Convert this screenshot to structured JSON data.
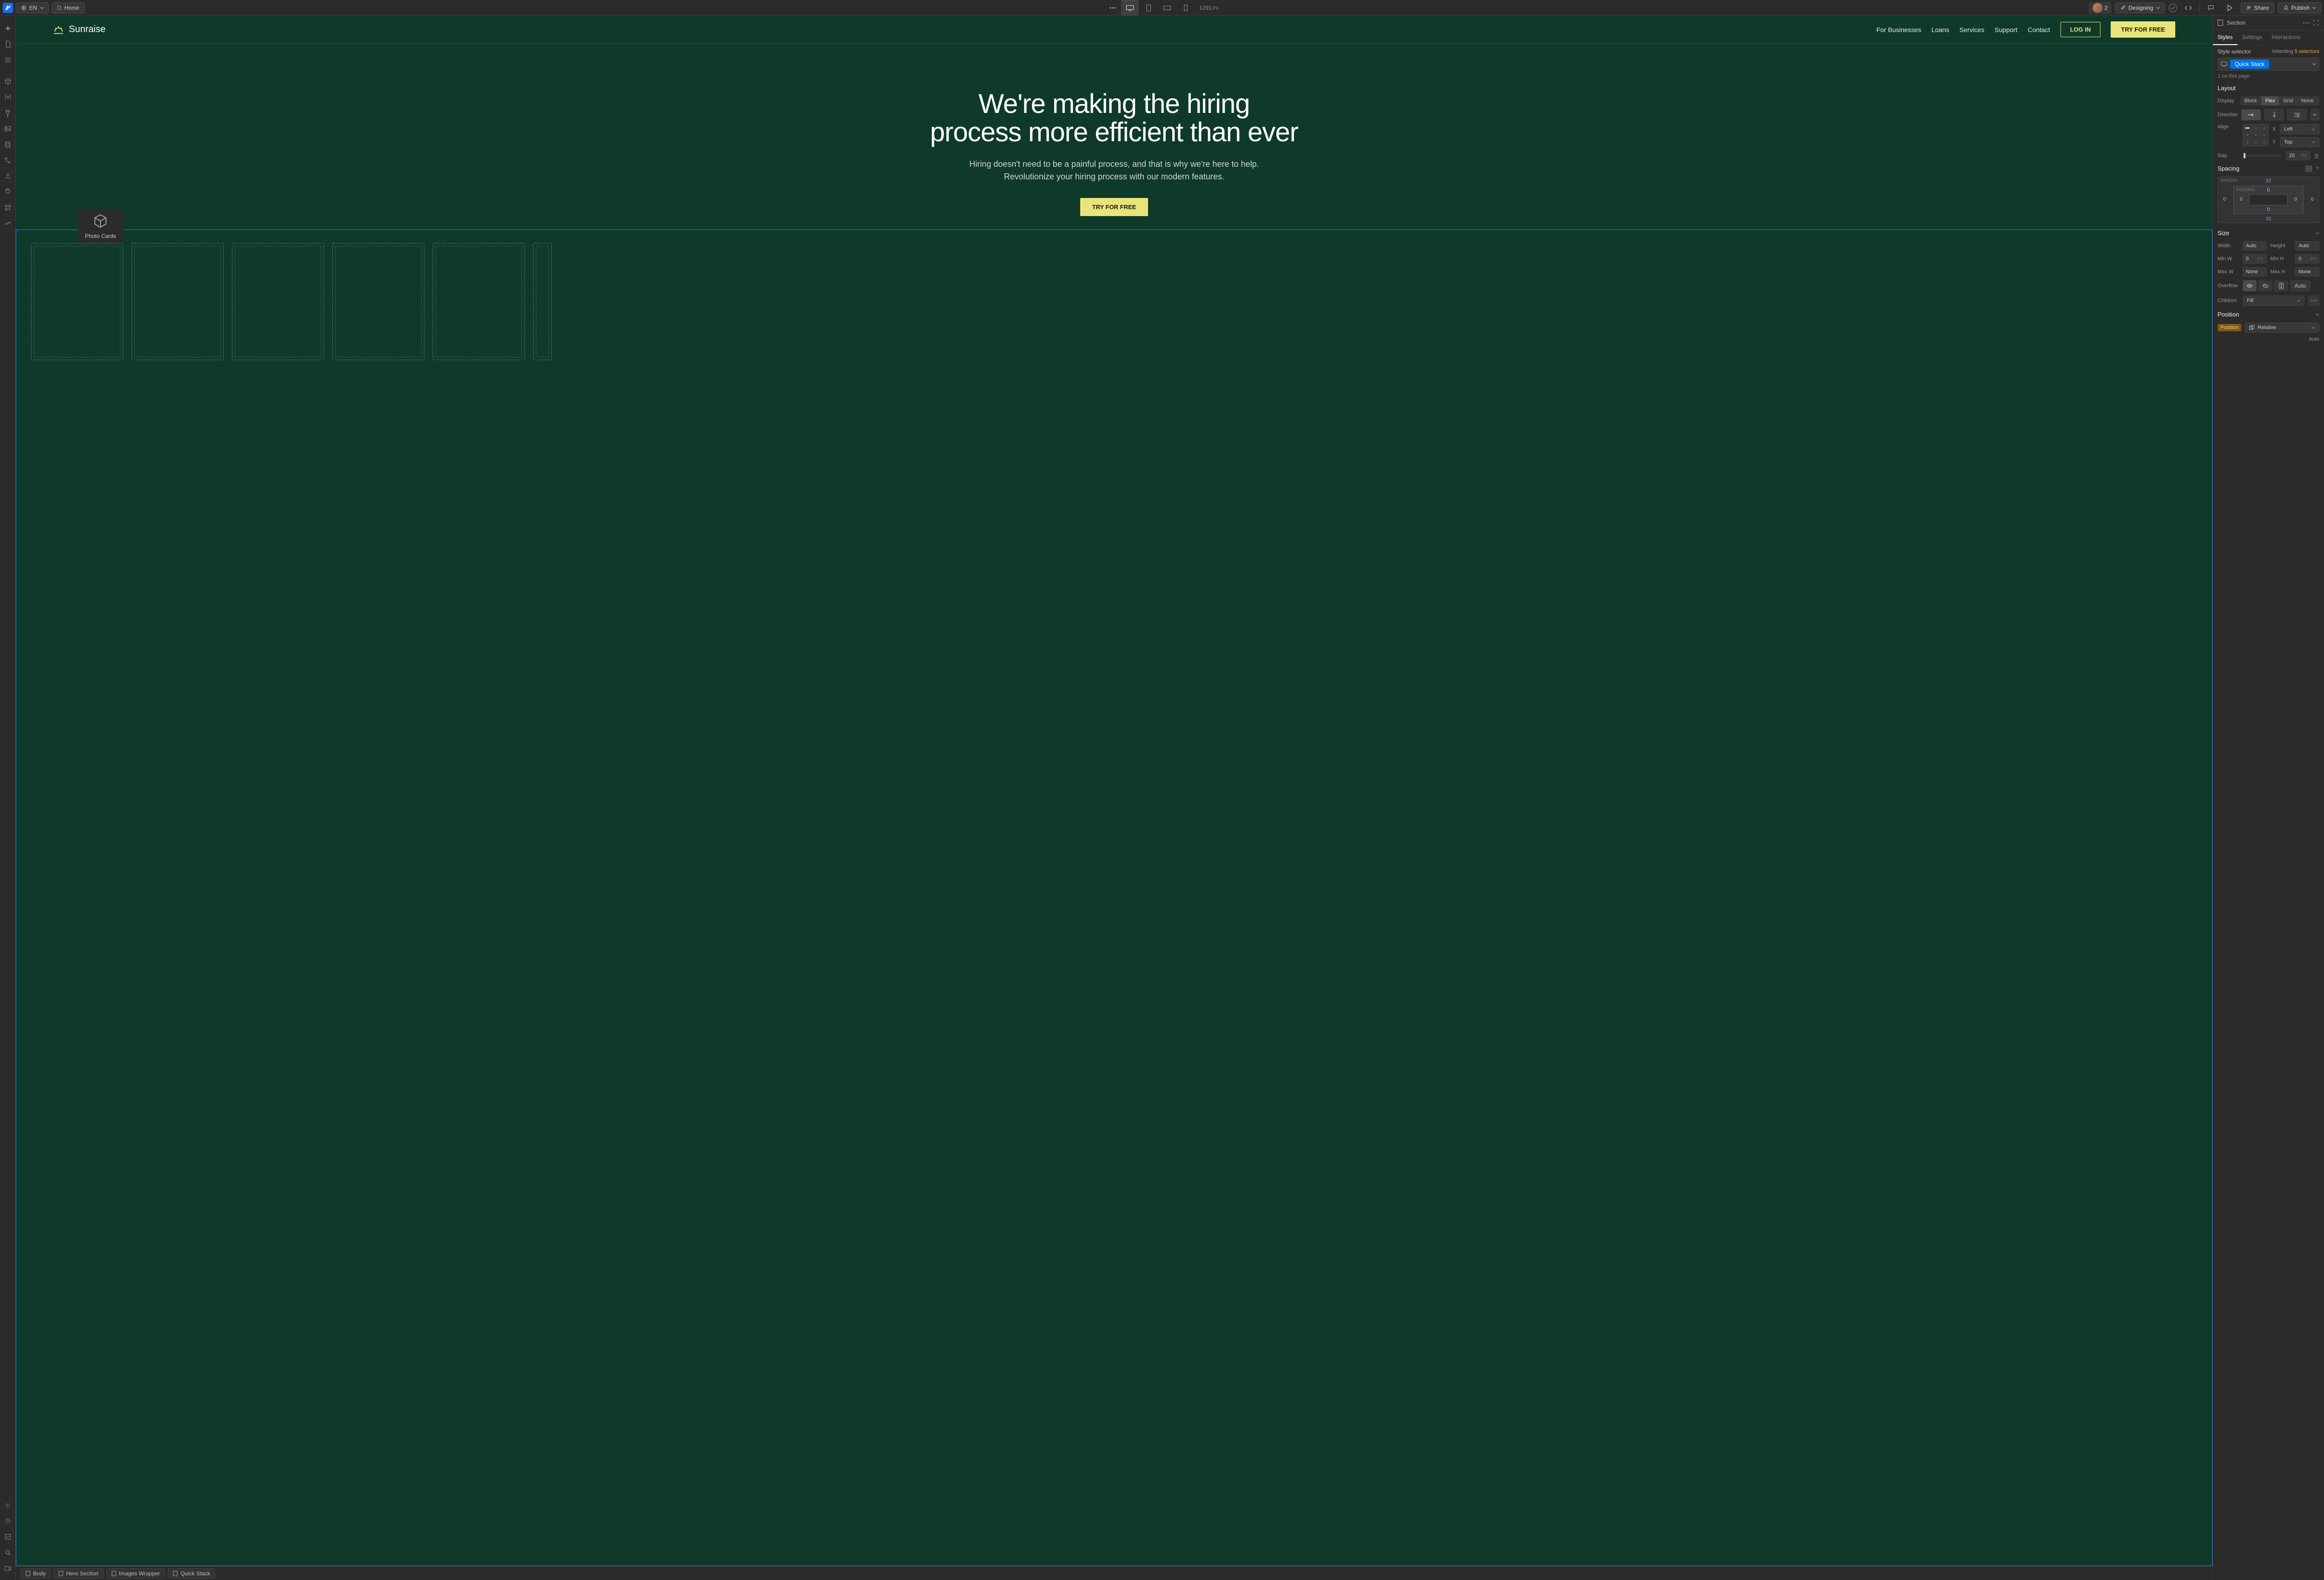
{
  "topbar": {
    "language": "EN",
    "page": "Home",
    "viewport_width": "1291",
    "viewport_unit": "PX",
    "user_count": "2",
    "mode_label": "Designing",
    "share_label": "Share",
    "publish_label": "Publish"
  },
  "site": {
    "brand": "Sunraise",
    "nav_items": [
      "For Businesses",
      "Loans",
      "Services",
      "Support",
      "Contact"
    ],
    "login": "LOG IN",
    "try_cta": "TRY FOR FREE"
  },
  "hero": {
    "headline_l1": "We're making the hiring",
    "headline_l2": "process more efficient than ever",
    "sub_l1": "Hiring doesn't need to be a painful process, and that is why we're here to help.",
    "sub_l2": "Revolutionize your hiring process with our modern features.",
    "cta": "TRY FOR FREE"
  },
  "selection_tag": "Photo Cards",
  "breadcrumb": [
    "Body",
    "Hero Section",
    "Images Wrapper",
    "Quick Stack"
  ],
  "right_panel": {
    "element_label": "Section",
    "tabs": [
      "Styles",
      "Settings",
      "Interactions"
    ],
    "style_selector_label": "Style selector",
    "inheriting_label": "Inheriting",
    "inheriting_count": "5 selectors",
    "selector_name": "Quick Stack",
    "on_page": "1 on this page",
    "layout": {
      "title": "Layout",
      "display_label": "Display",
      "display_options": [
        "Block",
        "Flex",
        "Grid",
        "None"
      ],
      "display_active": "Flex",
      "direction_label": "Direction",
      "align_label": "Align",
      "x_label": "X",
      "x_value": "Left",
      "y_label": "Y",
      "y_value": "Top",
      "gap_label": "Gap",
      "gap_value": "20",
      "gap_unit": "PX"
    },
    "spacing": {
      "title": "Spacing",
      "margin_label": "MARGIN",
      "padding_label": "PADDING",
      "margin_top": "32",
      "margin_bottom": "32",
      "margin_left": "0",
      "margin_right": "0",
      "padding_top": "0",
      "padding_bottom": "0",
      "padding_left": "0",
      "padding_right": "0"
    },
    "size": {
      "title": "Size",
      "width_label": "Width",
      "width_value": "Auto",
      "height_label": "Height",
      "height_value": "Auto",
      "minw_label": "Min W",
      "minw_value": "0",
      "minw_unit": "PX",
      "minh_label": "Min H",
      "minh_value": "0",
      "minh_unit": "PX",
      "maxw_label": "Max W",
      "maxw_value": "None",
      "maxh_label": "Max H",
      "maxh_value": "None",
      "overflow_label": "Overflow",
      "overflow_auto": "Auto",
      "children_label": "Children",
      "children_value": "Fill"
    },
    "position": {
      "title": "Position",
      "label": "Position",
      "value": "Relative",
      "auto": "Auto"
    }
  }
}
